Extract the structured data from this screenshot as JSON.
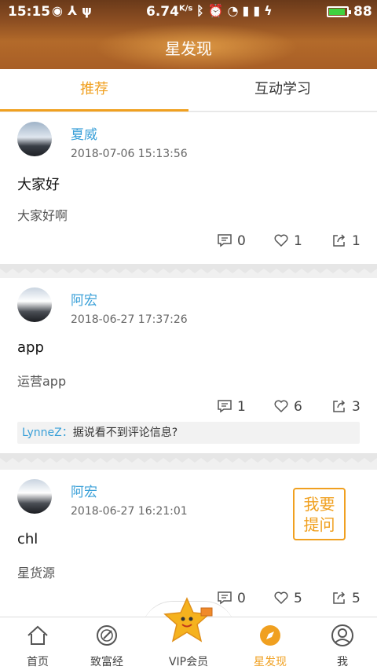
{
  "status_bar": {
    "time": "15:15",
    "speed": "6.74",
    "speed_unit": "K/s",
    "battery_level": "88",
    "left_icons": [
      "dot-circle-icon",
      "usb-share-icon",
      "usb-icon"
    ],
    "right_icons": [
      "bluetooth-icon",
      "alarm-icon",
      "wifi-icon",
      "signal-icon",
      "signal-4g-icon",
      "charging-icon",
      "battery-icon"
    ]
  },
  "header": {
    "title": "星发现"
  },
  "tabs": [
    {
      "label": "推荐",
      "active": true
    },
    {
      "label": "互动学习",
      "active": false
    }
  ],
  "posts": [
    {
      "user": "夏威",
      "time": "2018-07-06 15:13:56",
      "title": "大家好",
      "body": "大家好啊",
      "comments": "0",
      "likes": "1",
      "shares": "1"
    },
    {
      "user": "阿宏",
      "time": "2018-06-27 17:37:26",
      "title": "app",
      "body": "运营app",
      "comments": "1",
      "likes": "6",
      "shares": "3",
      "comment_preview": {
        "author": "LynneZ",
        "sep": "：",
        "text": "据说看不到评论信息?"
      }
    },
    {
      "user": "阿宏",
      "time": "2018-06-27 16:21:01",
      "title": "chl",
      "body": "星货源",
      "comments": "0",
      "likes": "5",
      "shares": "5"
    }
  ],
  "ask_button": {
    "line1": "我要",
    "line2": "提问"
  },
  "bottom_nav": [
    {
      "label": "首页",
      "icon": "home-icon"
    },
    {
      "label": "致富经",
      "icon": "compass-icon"
    },
    {
      "label": "VIP会员",
      "icon": "star-mascot-icon"
    },
    {
      "label": "星发现",
      "icon": "discover-icon",
      "active": true
    },
    {
      "label": "我",
      "icon": "profile-icon"
    }
  ],
  "colors": {
    "accent": "#f0a020",
    "link": "#3aa0d8",
    "header": "#9a5424"
  }
}
